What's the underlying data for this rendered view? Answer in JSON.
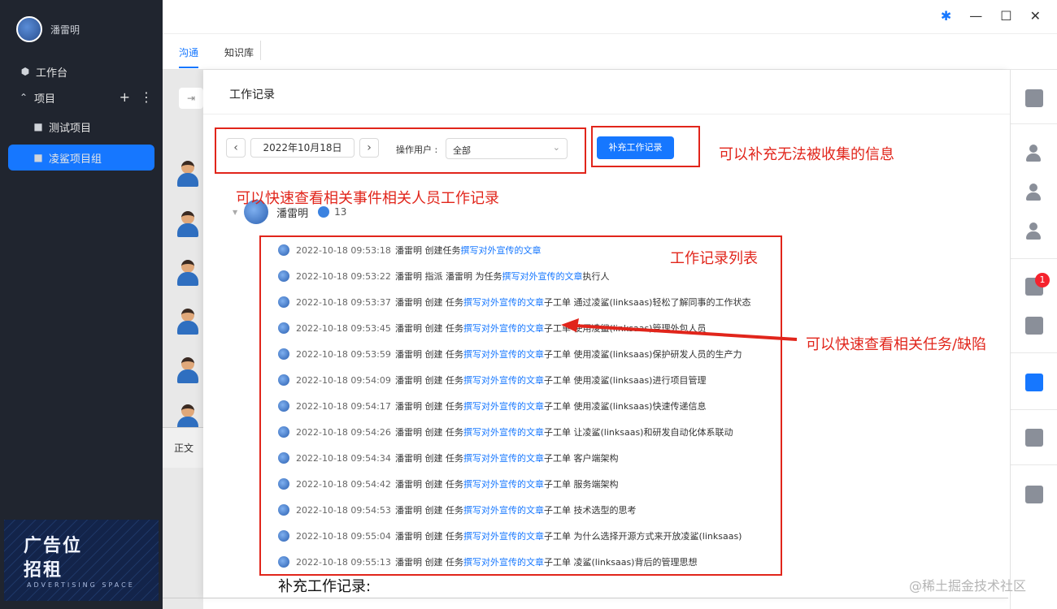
{
  "sidebar": {
    "user_name": "潘雷明",
    "workbench": "工作台",
    "projects_header": "项目",
    "projects": [
      {
        "label": "测试项目"
      },
      {
        "label": "凌鲨项目组"
      }
    ],
    "ad": {
      "line1": "广告位",
      "line2": "招租",
      "line3": "ADVERTISING SPACE"
    }
  },
  "tabs": [
    {
      "label": "沟通"
    },
    {
      "label": "知识库"
    }
  ],
  "chat": {
    "body_tab": "正文"
  },
  "panel": {
    "title": "工作记录",
    "date": "2022年10月18日",
    "operator_label": "操作用户 :",
    "operator_value": "全部",
    "add_button": "补充工作记录",
    "member": {
      "name": "潘雷明",
      "count": "13"
    },
    "records": [
      {
        "time": "2022-10-18 09:53:18",
        "pre": "潘雷明 创建任务 ",
        "link": "撰写对外宣传的文章",
        "post": ""
      },
      {
        "time": "2022-10-18 09:53:22",
        "pre": "潘雷明 指派 潘雷明 为任务 ",
        "link": "撰写对外宣传的文章",
        "post": " 执行人"
      },
      {
        "time": "2022-10-18 09:53:37",
        "pre": "潘雷明 创建 任务 ",
        "link": "撰写对外宣传的文章",
        "post": " 子工单 通过凌鲨(linksaas)轻松了解同事的工作状态"
      },
      {
        "time": "2022-10-18 09:53:45",
        "pre": "潘雷明 创建 任务 ",
        "link": "撰写对外宣传的文章",
        "post": " 子工单 使用凌鲨(linksaas)管理外包人员"
      },
      {
        "time": "2022-10-18 09:53:59",
        "pre": "潘雷明 创建 任务 ",
        "link": "撰写对外宣传的文章",
        "post": " 子工单 使用凌鲨(linksaas)保护研发人员的生产力"
      },
      {
        "time": "2022-10-18 09:54:09",
        "pre": "潘雷明 创建 任务 ",
        "link": "撰写对外宣传的文章",
        "post": " 子工单 使用凌鲨(linksaas)进行项目管理"
      },
      {
        "time": "2022-10-18 09:54:17",
        "pre": "潘雷明 创建 任务 ",
        "link": "撰写对外宣传的文章",
        "post": " 子工单 使用凌鲨(linksaas)快速传递信息"
      },
      {
        "time": "2022-10-18 09:54:26",
        "pre": "潘雷明 创建 任务 ",
        "link": "撰写对外宣传的文章",
        "post": " 子工单 让凌鲨(linksaas)和研发自动化体系联动"
      },
      {
        "time": "2022-10-18 09:54:34",
        "pre": "潘雷明 创建 任务 ",
        "link": "撰写对外宣传的文章",
        "post": " 子工单 客户端架构"
      },
      {
        "time": "2022-10-18 09:54:42",
        "pre": "潘雷明 创建 任务 ",
        "link": "撰写对外宣传的文章",
        "post": " 子工单 服务端架构"
      },
      {
        "time": "2022-10-18 09:54:53",
        "pre": "潘雷明 创建 任务 ",
        "link": "撰写对外宣传的文章",
        "post": " 子工单 技术选型的思考"
      },
      {
        "time": "2022-10-18 09:55:04",
        "pre": "潘雷明 创建 任务 ",
        "link": "撰写对外宣传的文章",
        "post": " 子工单 为什么选择开源方式来开放凌鲨(linksaas)"
      },
      {
        "time": "2022-10-18 09:55:13",
        "pre": "潘雷明 创建 任务 ",
        "link": "撰写对外宣传的文章",
        "post": " 子工单 凌鲨(linksaas)背后的管理思想"
      }
    ],
    "supplement_label": "补充工作记录:"
  },
  "rightbar": {
    "badge": "1"
  },
  "annotations": {
    "add_info": "可以补充无法被收集的信息",
    "quick_view_people": "可以快速查看相关事件相关人员工作记录",
    "list_title": "工作记录列表",
    "quick_view_task": "可以快速查看相关任务/缺陷"
  },
  "watermark": "@稀土掘金技术社区",
  "colors": {
    "accent": "#1677ff",
    "annotation": "#e1251b",
    "sidebar_bg": "#20252f"
  }
}
